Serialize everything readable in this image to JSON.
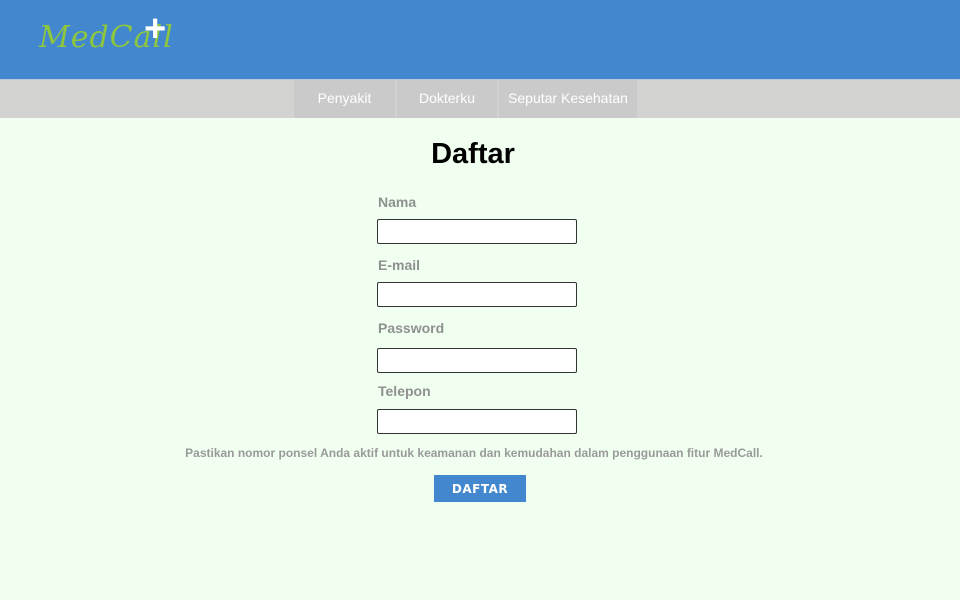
{
  "header": {
    "logo_text": "MedCall",
    "logo_plus": "+"
  },
  "nav": {
    "items": [
      {
        "label": "Penyakit"
      },
      {
        "label": "Dokterku"
      },
      {
        "label": "Seputar Kesehatan"
      }
    ]
  },
  "form": {
    "title": "Daftar",
    "fields": [
      {
        "label": "Nama",
        "value": ""
      },
      {
        "label": "E-mail",
        "value": ""
      },
      {
        "label": "Password",
        "value": ""
      },
      {
        "label": "Telepon",
        "value": ""
      }
    ],
    "note": "Pastikan nomor ponsel Anda aktif untuk keamanan dan kemudahan dalam penggunaan fitur MedCall.",
    "submit_label": "DAFTAR"
  },
  "colors": {
    "header": "#4387ce",
    "logo": "#8dc63f",
    "background": "#f0fff0",
    "nav": "#d2d3d1"
  }
}
